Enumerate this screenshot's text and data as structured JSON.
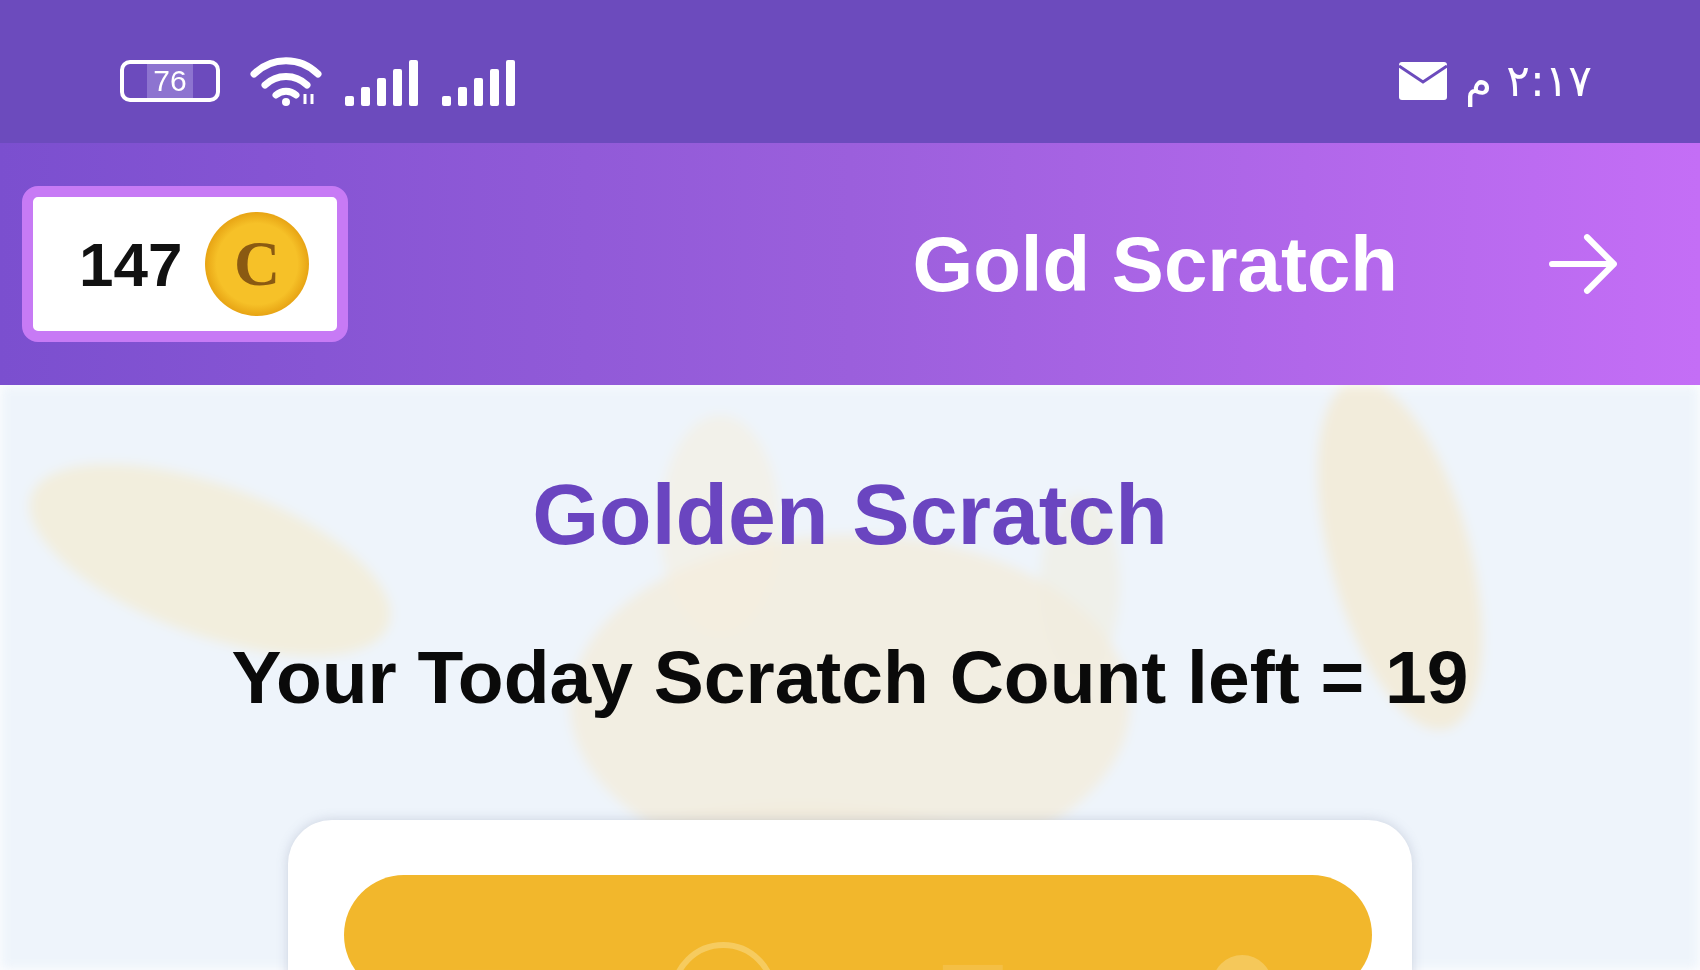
{
  "status_bar": {
    "battery": "76",
    "time": "٢:١٧ م"
  },
  "header": {
    "coins": "147",
    "coin_letter": "C",
    "title": "Gold Scratch"
  },
  "content": {
    "title": "Golden Scratch",
    "count_text": "Your Today Scratch Count left = 19"
  }
}
